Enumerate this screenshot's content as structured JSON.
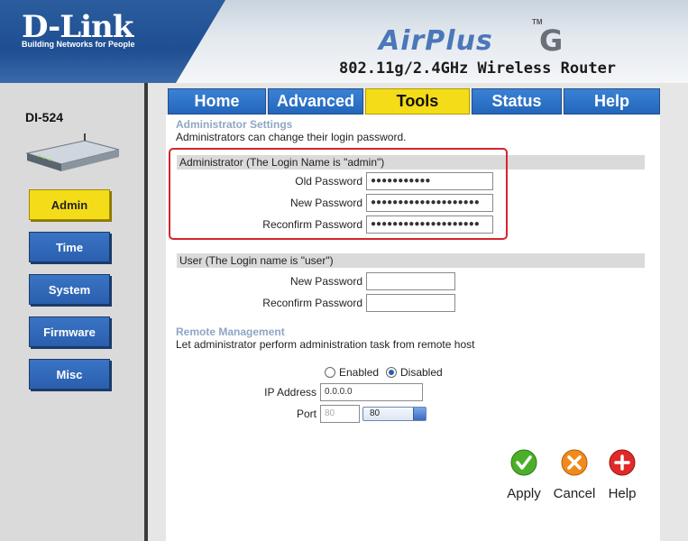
{
  "brand": {
    "logo": "D-Link",
    "tagline": "Building Networks for People"
  },
  "product": {
    "name_air": "AirPlus",
    "name_g": "G",
    "tm": "TM",
    "subtitle": "802.11g/2.4GHz Wireless Router"
  },
  "device": {
    "model": "DI-524"
  },
  "tabs": [
    {
      "label": "Home"
    },
    {
      "label": "Advanced"
    },
    {
      "label": "Tools"
    },
    {
      "label": "Status"
    },
    {
      "label": "Help"
    }
  ],
  "sidebar": {
    "items": [
      {
        "label": "Admin"
      },
      {
        "label": "Time"
      },
      {
        "label": "System"
      },
      {
        "label": "Firmware"
      },
      {
        "label": "Misc"
      }
    ]
  },
  "admin_settings": {
    "heading": "Administrator Settings",
    "description": "Administrators can change their login password."
  },
  "administrator": {
    "bar": "Administrator (The Login Name is \"admin\")",
    "old_password_label": "Old Password",
    "old_password_value": "●●●●●●●●●●●",
    "new_password_label": "New Password",
    "new_password_value": "●●●●●●●●●●●●●●●●●●●●",
    "reconfirm_label": "Reconfirm Password",
    "reconfirm_value": "●●●●●●●●●●●●●●●●●●●●"
  },
  "user": {
    "bar": "User (The Login name is \"user\")",
    "new_password_label": "New Password",
    "new_password_value": "",
    "reconfirm_label": "Reconfirm Password",
    "reconfirm_value": ""
  },
  "remote": {
    "heading": "Remote Management",
    "description": "Let administrator perform administration task from remote host",
    "enabled_label": "Enabled",
    "disabled_label": "Disabled",
    "selected": "Disabled",
    "ip_label": "IP Address",
    "ip_value": "0.0.0.0",
    "port_label": "Port",
    "port_value": "80",
    "port_select": "80"
  },
  "actions": {
    "apply": "Apply",
    "cancel": "Cancel",
    "help": "Help"
  },
  "colors": {
    "tab_blue": "#2a6fc4",
    "active_yellow": "#f4dc19",
    "highlight_red": "#d4262c",
    "apply_green": "#4caf2a",
    "cancel_orange": "#f08a1c",
    "help_red": "#e02a2a"
  }
}
